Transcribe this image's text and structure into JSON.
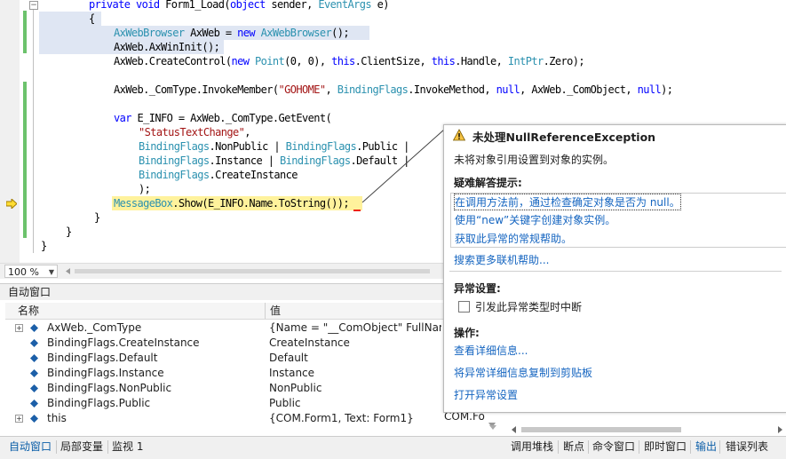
{
  "editor": {
    "lines": [
      [
        {
          "t": "private ",
          "c": "k"
        },
        {
          "t": "void ",
          "c": "k"
        },
        {
          "t": "Form1_Load(",
          "c": ""
        },
        {
          "t": "object ",
          "c": "k"
        },
        {
          "t": "sender, ",
          "c": ""
        },
        {
          "t": "EventArgs ",
          "c": "t"
        },
        {
          "t": "e)",
          "c": ""
        }
      ],
      [
        {
          "t": "{",
          "c": ""
        }
      ],
      [
        {
          "t": "AxWebBrowser ",
          "c": "t"
        },
        {
          "t": "AxWeb = ",
          "c": ""
        },
        {
          "t": "new ",
          "c": "k"
        },
        {
          "t": "AxWebBrowser",
          "c": "t"
        },
        {
          "t": "();",
          "c": ""
        }
      ],
      [
        {
          "t": "AxWeb.AxWinInit();",
          "c": ""
        }
      ],
      [
        {
          "t": "AxWeb.CreateControl(",
          "c": ""
        },
        {
          "t": "new ",
          "c": "k"
        },
        {
          "t": "Point",
          "c": "t"
        },
        {
          "t": "(0, 0), ",
          "c": ""
        },
        {
          "t": "this",
          "c": "k"
        },
        {
          "t": ".ClientSize, ",
          "c": ""
        },
        {
          "t": "this",
          "c": "k"
        },
        {
          "t": ".Handle, ",
          "c": ""
        },
        {
          "t": "IntPtr",
          "c": "t"
        },
        {
          "t": ".Zero);",
          "c": ""
        }
      ],
      [
        {
          "t": "AxWeb._ComType.InvokeMember(",
          "c": ""
        },
        {
          "t": "\"GOHOME\"",
          "c": "s"
        },
        {
          "t": ", ",
          "c": ""
        },
        {
          "t": "BindingFlags",
          "c": "t"
        },
        {
          "t": ".InvokeMethod, ",
          "c": ""
        },
        {
          "t": "null",
          "c": "k"
        },
        {
          "t": ", AxWeb._ComObject, ",
          "c": ""
        },
        {
          "t": "null",
          "c": "k"
        },
        {
          "t": ");",
          "c": ""
        }
      ],
      [
        {
          "t": "var ",
          "c": "k"
        },
        {
          "t": "E_INFO = AxWeb._ComType.GetEvent(",
          "c": ""
        }
      ],
      [
        {
          "t": "\"StatusTextChange\"",
          "c": "s"
        },
        {
          "t": ",",
          "c": ""
        }
      ],
      [
        {
          "t": "BindingFlags",
          "c": "t"
        },
        {
          "t": ".NonPublic | ",
          "c": ""
        },
        {
          "t": "BindingFlags",
          "c": "t"
        },
        {
          "t": ".Public |",
          "c": ""
        }
      ],
      [
        {
          "t": "BindingFlags",
          "c": "t"
        },
        {
          "t": ".Instance | ",
          "c": ""
        },
        {
          "t": "BindingFlags",
          "c": "t"
        },
        {
          "t": ".Default |",
          "c": ""
        }
      ],
      [
        {
          "t": "BindingFlags",
          "c": "t"
        },
        {
          "t": ".CreateInstance",
          "c": ""
        }
      ],
      [
        {
          "t": ");",
          "c": ""
        }
      ],
      [
        {
          "t": "MessageBox",
          "c": "t"
        },
        {
          "t": ".Show(E_INFO.Name.ToString());",
          "c": ""
        }
      ],
      [
        {
          "t": "}",
          "c": ""
        }
      ],
      [
        {
          "t": "}",
          "c": ""
        }
      ],
      [
        {
          "t": "}",
          "c": ""
        }
      ]
    ],
    "zoom": "100 %"
  },
  "autos": {
    "title": "自动窗口",
    "col_name": "名称",
    "col_value": "值",
    "rows": [
      {
        "name": "AxWeb._ComType",
        "value": "{Name = \"__ComObject\" FullName = \"System.__ComObject\"}",
        "expandable": true
      },
      {
        "name": "BindingFlags.CreateInstance",
        "value": "CreateInstance",
        "expandable": false
      },
      {
        "name": "BindingFlags.Default",
        "value": "Default",
        "expandable": false
      },
      {
        "name": "BindingFlags.Instance",
        "value": "Instance",
        "expandable": false
      },
      {
        "name": "BindingFlags.NonPublic",
        "value": "NonPublic",
        "expandable": false
      },
      {
        "name": "BindingFlags.Public",
        "value": "Public",
        "expandable": false
      },
      {
        "name": "this",
        "value": "{COM.Form1, Text: Form1}",
        "expandable": true
      }
    ],
    "type_col_partial": "COM.Fo"
  },
  "exception": {
    "title": "未处理NullReferenceException",
    "message": "未将对象引用设置到对象的实例。",
    "tips_heading": "疑难解答提示:",
    "tips": [
      "在调用方法前，通过检查确定对象是否为 null。",
      "使用“new”关键字创建对象实例。",
      "获取此异常的常规帮助。"
    ],
    "search_more": "搜索更多联机帮助...",
    "settings_heading": "异常设置:",
    "break_checkbox": "引发此异常类型时中断",
    "actions_heading": "操作:",
    "actions": [
      "查看详细信息...",
      "将异常详细信息复制到剪贴板",
      "打开异常设置"
    ]
  },
  "bottom_tabs": {
    "left": [
      "自动窗口",
      "局部变量",
      "监视 1"
    ],
    "right": [
      "调用堆栈",
      "断点",
      "命令窗口",
      "即时窗口",
      "输出",
      "错误列表"
    ]
  },
  "colors": {
    "keyword": "#0000ff",
    "type": "#2b91af",
    "string": "#a31515",
    "link": "#1565c0",
    "changed": "#6cc26c",
    "current_statement": "#fff29c"
  }
}
